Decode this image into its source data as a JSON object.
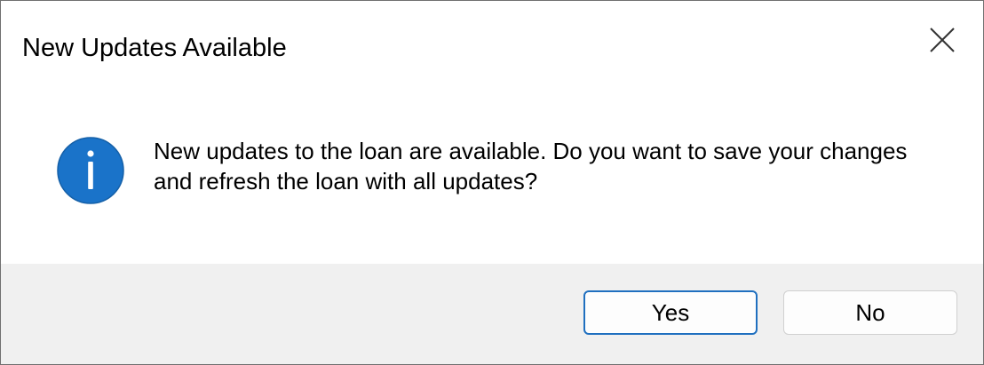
{
  "dialog": {
    "title": "New Updates Available",
    "close_icon": "close-icon",
    "info_icon": "info-icon",
    "message": "New updates to the loan are available. Do you want to save your changes and refresh the loan with all updates?",
    "buttons": {
      "yes_label": "Yes",
      "no_label": "No"
    },
    "default_button": "Yes"
  },
  "colors": {
    "info_icon_fill": "#1a73c9",
    "default_button_border": "#1f6fbf",
    "footer_background": "#f0f0f0"
  }
}
